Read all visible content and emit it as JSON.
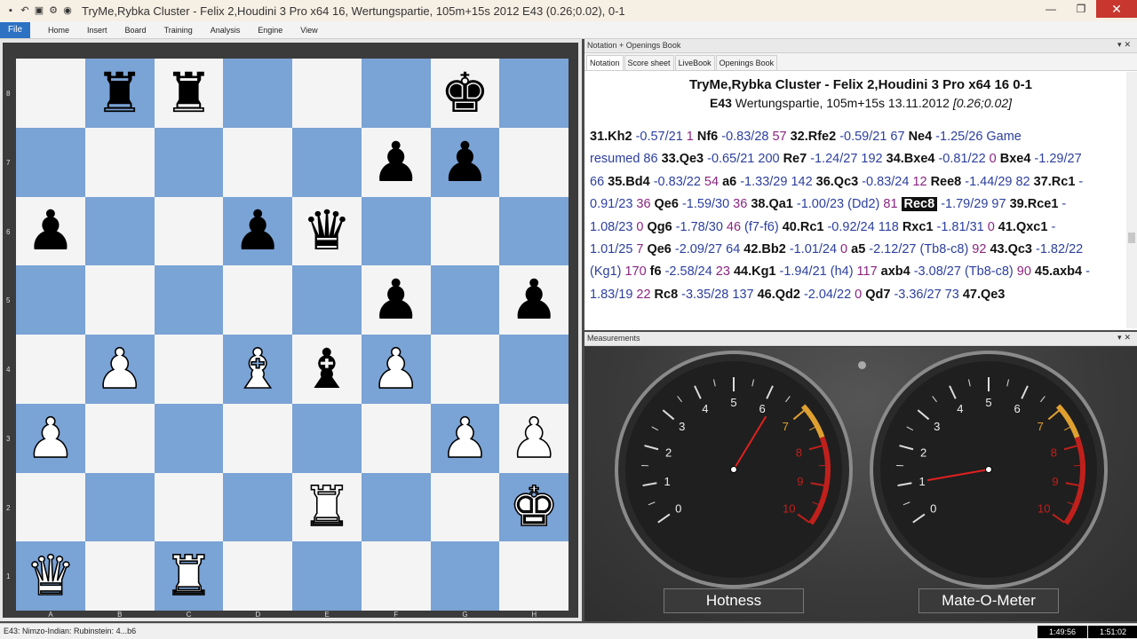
{
  "window": {
    "title": "TryMe,Rybka Cluster - Felix 2,Houdini 3 Pro x64 16, Wertungspartie, 105m+15s 2012  E43  (0.26;0.02), 0-1",
    "controls": [
      "—",
      "❐",
      "✕"
    ]
  },
  "menu": {
    "file": "File",
    "items": [
      "Home",
      "Insert",
      "Board",
      "Training",
      "Analysis",
      "Engine",
      "View"
    ]
  },
  "board": {
    "ranks": [
      "8",
      "7",
      "6",
      "5",
      "4",
      "3",
      "2",
      "1"
    ],
    "files": [
      "A",
      "B",
      "C",
      "D",
      "E",
      "F",
      "G",
      "H"
    ],
    "pieces": [
      [
        "",
        "r",
        "r",
        "",
        "",
        "",
        "k",
        ""
      ],
      [
        "",
        "",
        "",
        "",
        "",
        "p",
        "p",
        ""
      ],
      [
        "p",
        "",
        "",
        "p",
        "q",
        "",
        "",
        ""
      ],
      [
        "",
        "",
        "",
        "",
        "",
        "p",
        "",
        "p"
      ],
      [
        "",
        "P",
        "",
        "B",
        "b",
        "P",
        "",
        ""
      ],
      [
        "P",
        "",
        "",
        "",
        "",
        "",
        "P",
        "P"
      ],
      [
        "",
        "",
        "",
        "",
        "R",
        "",
        "",
        "K"
      ],
      [
        "Q",
        "",
        "R",
        "",
        "",
        "",
        "",
        ""
      ]
    ]
  },
  "notation": {
    "panel_title": "Notation + Openings Book",
    "tabs": [
      "Notation",
      "Score sheet",
      "LiveBook",
      "Openings Book"
    ],
    "header1": "TryMe,Rybka Cluster - Felix 2,Houdini 3 Pro x64 16  0-1",
    "header2_eco": "E43",
    "header2_text": "Wertungspartie, 105m+15s 13.11.2012",
    "header2_eval": "[0.26;0.02]",
    "moves": [
      {
        "t": "m",
        "v": "31.Kh2"
      },
      {
        "t": "e",
        "v": "-0.57/21"
      },
      {
        "t": "d",
        "v": "1"
      },
      {
        "t": "m",
        "v": "Nf6"
      },
      {
        "t": "e",
        "v": "-0.83/28"
      },
      {
        "t": "d",
        "v": "57"
      },
      {
        "t": "m",
        "v": "32.Rfe2"
      },
      {
        "t": "e",
        "v": "-0.59/21 67"
      },
      {
        "t": "m",
        "v": "Ne4"
      },
      {
        "t": "e",
        "v": "-1.25/26"
      },
      {
        "t": "c",
        "v": "Game resumed"
      },
      {
        "t": "e",
        "v": "86"
      },
      {
        "t": "m",
        "v": "33.Qe3"
      },
      {
        "t": "e",
        "v": "-0.65/21 200"
      },
      {
        "t": "m",
        "v": "Re7"
      },
      {
        "t": "e",
        "v": "-1.24/27 192"
      },
      {
        "t": "m",
        "v": "34.Bxe4"
      },
      {
        "t": "e",
        "v": "-0.81/22"
      },
      {
        "t": "d",
        "v": "0"
      },
      {
        "t": "m",
        "v": "Bxe4"
      },
      {
        "t": "e",
        "v": "-1.29/27 66"
      },
      {
        "t": "m",
        "v": "35.Bd4"
      },
      {
        "t": "e",
        "v": "-0.83/22"
      },
      {
        "t": "d",
        "v": "54"
      },
      {
        "t": "m",
        "v": "a6"
      },
      {
        "t": "e",
        "v": "-1.33/29 142"
      },
      {
        "t": "m",
        "v": "36.Qc3"
      },
      {
        "t": "e",
        "v": "-0.83/24"
      },
      {
        "t": "d",
        "v": "12"
      },
      {
        "t": "m",
        "v": "Ree8"
      },
      {
        "t": "e",
        "v": "-1.44/29 82"
      },
      {
        "t": "m",
        "v": "37.Rc1"
      },
      {
        "t": "e",
        "v": "-0.91/23"
      },
      {
        "t": "d",
        "v": "36"
      },
      {
        "t": "m",
        "v": "Qe6"
      },
      {
        "t": "e",
        "v": "-1.59/30"
      },
      {
        "t": "d",
        "v": "36"
      },
      {
        "t": "m",
        "v": "38.Qa1"
      },
      {
        "t": "e",
        "v": "-1.00/23"
      },
      {
        "t": "e",
        "v": "(Dd2)"
      },
      {
        "t": "d",
        "v": "81"
      },
      {
        "t": "cur",
        "v": "Rec8"
      },
      {
        "t": "e",
        "v": "-1.79/29 97"
      },
      {
        "t": "m",
        "v": "39.Rce1"
      },
      {
        "t": "e",
        "v": "-1.08/23"
      },
      {
        "t": "d",
        "v": "0"
      },
      {
        "t": "m",
        "v": "Qg6"
      },
      {
        "t": "e",
        "v": "-1.78/30"
      },
      {
        "t": "d",
        "v": "46"
      },
      {
        "t": "e",
        "v": "(f7-f6)"
      },
      {
        "t": "m",
        "v": "40.Rc1"
      },
      {
        "t": "e",
        "v": "-0.92/24 118"
      },
      {
        "t": "m",
        "v": "Rxc1"
      },
      {
        "t": "e",
        "v": "-1.81/31"
      },
      {
        "t": "d",
        "v": "0"
      },
      {
        "t": "m",
        "v": "41.Qxc1"
      },
      {
        "t": "e",
        "v": "-1.01/25"
      },
      {
        "t": "d",
        "v": "7"
      },
      {
        "t": "m",
        "v": "Qe6"
      },
      {
        "t": "e",
        "v": "-2.09/27 64"
      },
      {
        "t": "m",
        "v": "42.Bb2"
      },
      {
        "t": "e",
        "v": "-1.01/24"
      },
      {
        "t": "d",
        "v": "0"
      },
      {
        "t": "m",
        "v": "a5"
      },
      {
        "t": "e",
        "v": "-2.12/27 (Tb8-c8)"
      },
      {
        "t": "d",
        "v": "92"
      },
      {
        "t": "m",
        "v": "43.Qc3"
      },
      {
        "t": "e",
        "v": "-1.82/22 (Kg1)"
      },
      {
        "t": "d",
        "v": "170"
      },
      {
        "t": "m",
        "v": "f6"
      },
      {
        "t": "e",
        "v": "-2.58/24"
      },
      {
        "t": "d",
        "v": "23"
      },
      {
        "t": "m",
        "v": "44.Kg1"
      },
      {
        "t": "e",
        "v": "-1.94/21 (h4)"
      },
      {
        "t": "d",
        "v": "117"
      },
      {
        "t": "m",
        "v": "axb4"
      },
      {
        "t": "e",
        "v": "-3.08/27 (Tb8-c8)"
      },
      {
        "t": "d",
        "v": "90"
      },
      {
        "t": "m",
        "v": "45.axb4"
      },
      {
        "t": "e",
        "v": "-1.83/19"
      },
      {
        "t": "d",
        "v": "22"
      },
      {
        "t": "m",
        "v": "Rc8"
      },
      {
        "t": "e",
        "v": "-3.35/28 137"
      },
      {
        "t": "m",
        "v": "46.Qd2"
      },
      {
        "t": "e",
        "v": "-2.04/22"
      },
      {
        "t": "d",
        "v": "0"
      },
      {
        "t": "m",
        "v": "Qd7"
      },
      {
        "t": "e",
        "v": "-3.36/27 73"
      },
      {
        "t": "m",
        "v": "47.Qe3"
      }
    ]
  },
  "measurements": {
    "panel_title": "Measurements",
    "gauges": [
      {
        "label": "Hotness",
        "value": 6.25,
        "ticks": [
          "0",
          "1",
          "2",
          "3",
          "4",
          "5",
          "6",
          "7",
          "8",
          "9",
          "10"
        ]
      },
      {
        "label": "Mate-O-Meter",
        "value": 1.0,
        "ticks": [
          "0",
          "1",
          "2",
          "3",
          "4",
          "5",
          "6",
          "7",
          "8",
          "9",
          "10"
        ]
      }
    ],
    "colors": {
      "needle": "#e02020",
      "warm": "#e0a030",
      "hot": "#c0201c"
    }
  },
  "status": {
    "opening": "E43: Nimzo-Indian: Rubinstein: 4...b6",
    "clock_white": "1:49:56",
    "clock_black": "1:51:02"
  }
}
